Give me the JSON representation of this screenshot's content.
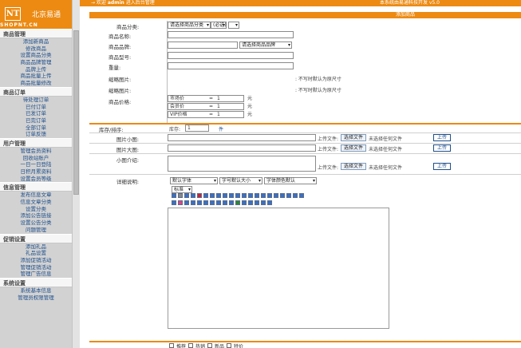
{
  "sidebar": {
    "logo_badge": "NT",
    "logo_name": "北京易通",
    "logo_domain": "SHOPNT.CN",
    "groups": [
      {
        "title": "商品管理",
        "items": [
          "添加新商品",
          "修改商品",
          "设置商品分类",
          "商品品牌管理",
          "品牌上传",
          "商品批量上传",
          "商品批量修改"
        ]
      },
      {
        "title": "商品订单",
        "items": [
          "待处理订单",
          "已付订单",
          "已发订单",
          "已完订单",
          "全部订单",
          "订单反馈"
        ]
      },
      {
        "title": "用户管理",
        "items": [
          "管理会员资料",
          "回收站账户",
          "一日一日登陆",
          "日积月累资料",
          "设置会员等级"
        ]
      },
      {
        "title": "信息管理",
        "items": [
          "发布信息文章",
          "信息文章分类",
          "设置分类",
          "添加公告链接",
          "设置公告分类",
          "问题管理"
        ]
      },
      {
        "title": "促销设置",
        "items": [
          "添加礼品",
          "礼品设置",
          "添加促销活动",
          "管理促销活动",
          "管理广告信息"
        ]
      },
      {
        "title": "系统设置",
        "items": [
          "系统基本信息",
          "管理员权限管理"
        ]
      }
    ]
  },
  "topbar": {
    "crumb_prefix": "→ 欢迎",
    "user": "admin",
    "crumb_suffix": "进入后台管理",
    "right_text": "本系统由易通科技开发 v5.0"
  },
  "form_title": "添加商品",
  "form_title_right": "",
  "labels": {
    "category": "商品分类:",
    "name": "商品名称:",
    "brand": "商品品牌:",
    "model": "商品型号:",
    "weight": "重量:",
    "small_pic": "缩略图片:",
    "big_pic": "缩略图片:",
    "price": "商品价格:",
    "stock": "库存/排序:",
    "pic_small": "图片小图:",
    "pic_big": "图片大图:",
    "desc": "小图介绍:",
    "detail": "详细说明:"
  },
  "category_select": "请选择商品分类",
  "category_extra": "(必选)",
  "brand_select": "请选择商品品牌",
  "brand_hint": "",
  "size_note_1": ": 不写时默认为原尺寸",
  "size_note_2": ": 不写时默认为原尺寸",
  "prices": [
    {
      "label": "市场价",
      "eq": "=",
      "val": "1",
      "unit": "元"
    },
    {
      "label": "会员价",
      "eq": "=",
      "val": "1",
      "unit": "元"
    },
    {
      "label": "VIP价格",
      "eq": "=",
      "val": "1",
      "unit": "元"
    }
  ],
  "stock": {
    "prefix": "库存:",
    "value": "1",
    "extra": "件"
  },
  "upload": {
    "label": "上传文件:",
    "choose": "选择文件",
    "none": "未选择任何文件",
    "submit": "上传"
  },
  "editor": {
    "font_select": "默认字体",
    "size_select": "字号默认大小",
    "color_select": "字体颜色默认",
    "style_select": "标准"
  },
  "checkboxes": [
    "推荐",
    "热销",
    "新品",
    "特价"
  ]
}
